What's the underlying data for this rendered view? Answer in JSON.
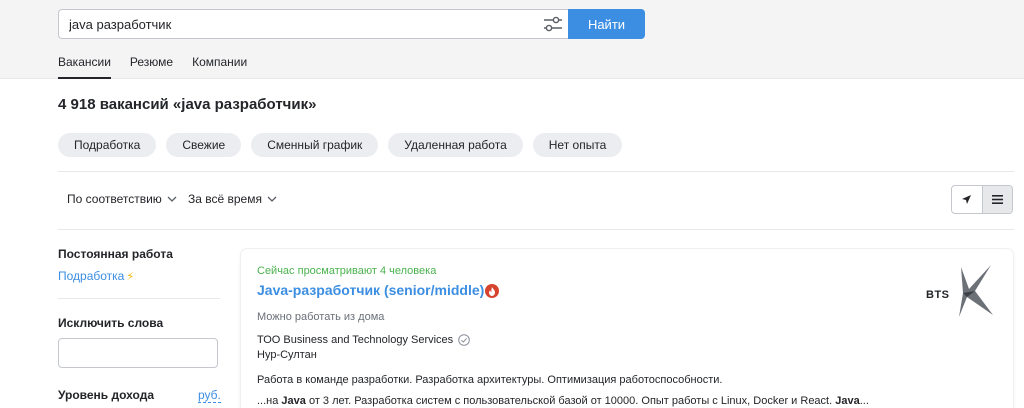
{
  "search": {
    "query": "java разработчик",
    "button_label": "Найти"
  },
  "tabs": [
    {
      "label": "Вакансии",
      "active": true
    },
    {
      "label": "Резюме",
      "active": false
    },
    {
      "label": "Компании",
      "active": false
    }
  ],
  "results_title": "4 918 вакансий «java разработчик»",
  "chips": [
    "Подработка",
    "Свежие",
    "Сменный график",
    "Удаленная работа",
    "Нет опыта"
  ],
  "sort": {
    "relevance_label": "По соответствию",
    "period_label": "За всё время"
  },
  "sidebar": {
    "employment_label": "Постоянная работа",
    "employment_link": "Подработка",
    "exclude_label": "Исключить слова",
    "exclude_value": "",
    "income_label": "Уровень дохода",
    "currency_link": "руб."
  },
  "vacancy": {
    "watching": "Сейчас просматривают 4 человека",
    "title": "Java-разработчик (senior/middle)",
    "remote": "Можно работать из дома",
    "company": "ТОО Business and Technology Services",
    "city": "Нур-Султан",
    "desc_line1": "Работа в команде разработки. Разработка архитектуры. Оптимизация работоспособности.",
    "desc_line2_pre": "...на ",
    "desc_line2_b1": "Java",
    "desc_line2_mid": " от 3 лет. Разработка систем с пользовательской базой от 10000. Опыт работы с Linux, Docker и React. ",
    "desc_line2_b2": "Java",
    "desc_line2_post": "...",
    "logo_text": "BTS"
  },
  "colors": {
    "accent": "#3c8ee2",
    "green": "#4bb24e",
    "hot": "#d6442e"
  },
  "icons": [
    "filter-sliders-icon",
    "chevron-down-icon",
    "map-arrow-icon",
    "list-view-icon",
    "fire-icon",
    "verified-check-icon",
    "bolt-icon"
  ]
}
